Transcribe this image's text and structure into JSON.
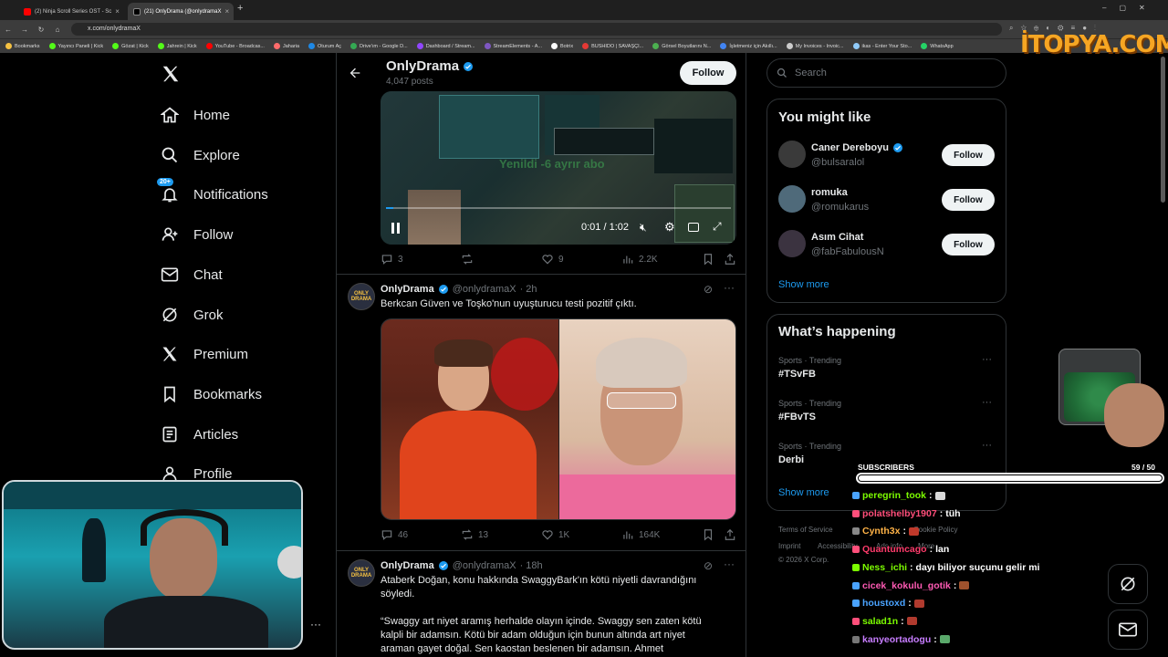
{
  "browser": {
    "tabs": [
      {
        "title": "(2) Ninja Scroll Series OST - Sc",
        "color": "#ff0000"
      },
      {
        "title": "(21) OnlyDrama (@onlydramaX",
        "color": "#ffffff"
      }
    ],
    "url": "x.com/onlydramaX",
    "bookmarks": [
      "Bookmarks",
      "Yayıncı Paneli | Kick",
      "Gözat | Kick",
      "Jahrein | Kick",
      "YouTube - Broadcas...",
      "Jaharia",
      "Oturum Aç",
      "Drive'ım - Google D...",
      "Dashboard / Stream...",
      "StreamElements - A...",
      "Botrix",
      "BUSHIDO | SAVAŞÇI...",
      "Görsel Boyutlarını N...",
      "İşletmeniz için Akıllı...",
      "My Invoices - Invoic...",
      "ikas - Enter Your Sto...",
      "WhatsApp"
    ],
    "watermark": "İTOPYA.COM"
  },
  "nav": {
    "logo": "X",
    "items": [
      {
        "label": "Home",
        "icon": "home-icon"
      },
      {
        "label": "Explore",
        "icon": "search-icon"
      },
      {
        "label": "Notifications",
        "icon": "bell-icon",
        "badge": "20+"
      },
      {
        "label": "Follow",
        "icon": "follow-icon"
      },
      {
        "label": "Chat",
        "icon": "mail-icon"
      },
      {
        "label": "Grok",
        "icon": "grok-icon"
      },
      {
        "label": "Premium",
        "icon": "x-icon"
      },
      {
        "label": "Bookmarks",
        "icon": "bookmark-icon"
      },
      {
        "label": "Articles",
        "icon": "articles-icon"
      },
      {
        "label": "Profile",
        "icon": "person-icon"
      }
    ]
  },
  "profile_header": {
    "name": "OnlyDrama",
    "posts": "4,047 posts",
    "follow": "Follow"
  },
  "tweets": [
    {
      "video": {
        "overlay_text": "Yenildi -6 ayrır abo",
        "time": "0:01 / 1:02",
        "progress": 0.02
      },
      "stats": {
        "replies": "3",
        "reposts": "",
        "likes": "9",
        "views": "2.2K"
      }
    },
    {
      "name": "OnlyDrama",
      "handle": "@onlydramaX",
      "time": "· 2h",
      "text": "Berkcan Güven ve Toşko'nun uyuşturucu testi pozitif çıktı.",
      "stats": {
        "replies": "46",
        "reposts": "13",
        "likes": "1K",
        "views": "164K"
      }
    },
    {
      "name": "OnlyDrama",
      "handle": "@onlydramaX",
      "time": "· 18h",
      "text_lines": [
        "Ataberk Doğan, konu hakkında SwaggyBark'ın kötü niyetli davrandığını",
        "söyledi.",
        "",
        "“Swaggy art niyet aramış herhalde olayın içinde. Swaggy sen zaten kötü",
        "kalpli bir adamsın. Kötü bir adam olduğun için bunun altında art niyet",
        "araman gayet doğal. Sen kaostan beslenen bir adamsın. Ahmet"
      ]
    }
  ],
  "search": {
    "placeholder": "Search"
  },
  "you_might_like": {
    "title": "You might like",
    "users": [
      {
        "name": "Caner Dereboyu",
        "handle": "@bulsaralol",
        "verified": true,
        "follow": "Follow"
      },
      {
        "name": "romuka",
        "handle": "@romukarus",
        "verified": false,
        "follow": "Follow"
      },
      {
        "name": "Asım Cihat",
        "handle": "@fabFabulousN",
        "verified": false,
        "follow": "Follow"
      }
    ],
    "show_more": "Show more"
  },
  "whats_happening": {
    "title": "What’s happening",
    "trends": [
      {
        "meta": "Sports · Trending",
        "name": "#TSvFB"
      },
      {
        "meta": "Sports · Trending",
        "name": "#FBvTS"
      },
      {
        "meta": "Sports · Trending",
        "name": "Derbi"
      }
    ],
    "show_more": "Show more"
  },
  "footer": {
    "links": [
      "Terms of Service",
      "Cookie Policy",
      "Imprint",
      "Accessibility",
      "Ads info",
      "More"
    ],
    "copyright": "© 2026 X Corp."
  },
  "stream_overlay": {
    "subscribers_label": "SUBSCRIBERS",
    "subscribers_count": "59 / 50",
    "chat": [
      {
        "user": "peregrin_took",
        "msg": "",
        "color": "#7cfc00"
      },
      {
        "user": "polatshelby1907",
        "msg": "tüh",
        "color": "#ff4f7b"
      },
      {
        "user": "Cynth3x",
        "msg": "",
        "color": "#ffb347"
      },
      {
        "user": "Quantumcago",
        "msg": "lan",
        "color": "#ff3b6b"
      },
      {
        "user": "Ness_ichi",
        "msg": "dayı biliyor suçunu gelir mi",
        "color": "#7cfc00"
      },
      {
        "user": "cicek_kokulu_gotik",
        "msg": "",
        "color": "#ff5ab4"
      },
      {
        "user": "houstoxd",
        "msg": "",
        "color": "#4aa3ff"
      },
      {
        "user": "salad1n",
        "msg": "",
        "color": "#7cfc00"
      },
      {
        "user": "kanyeortadogu",
        "msg": "",
        "color": "#c77dff"
      }
    ]
  }
}
